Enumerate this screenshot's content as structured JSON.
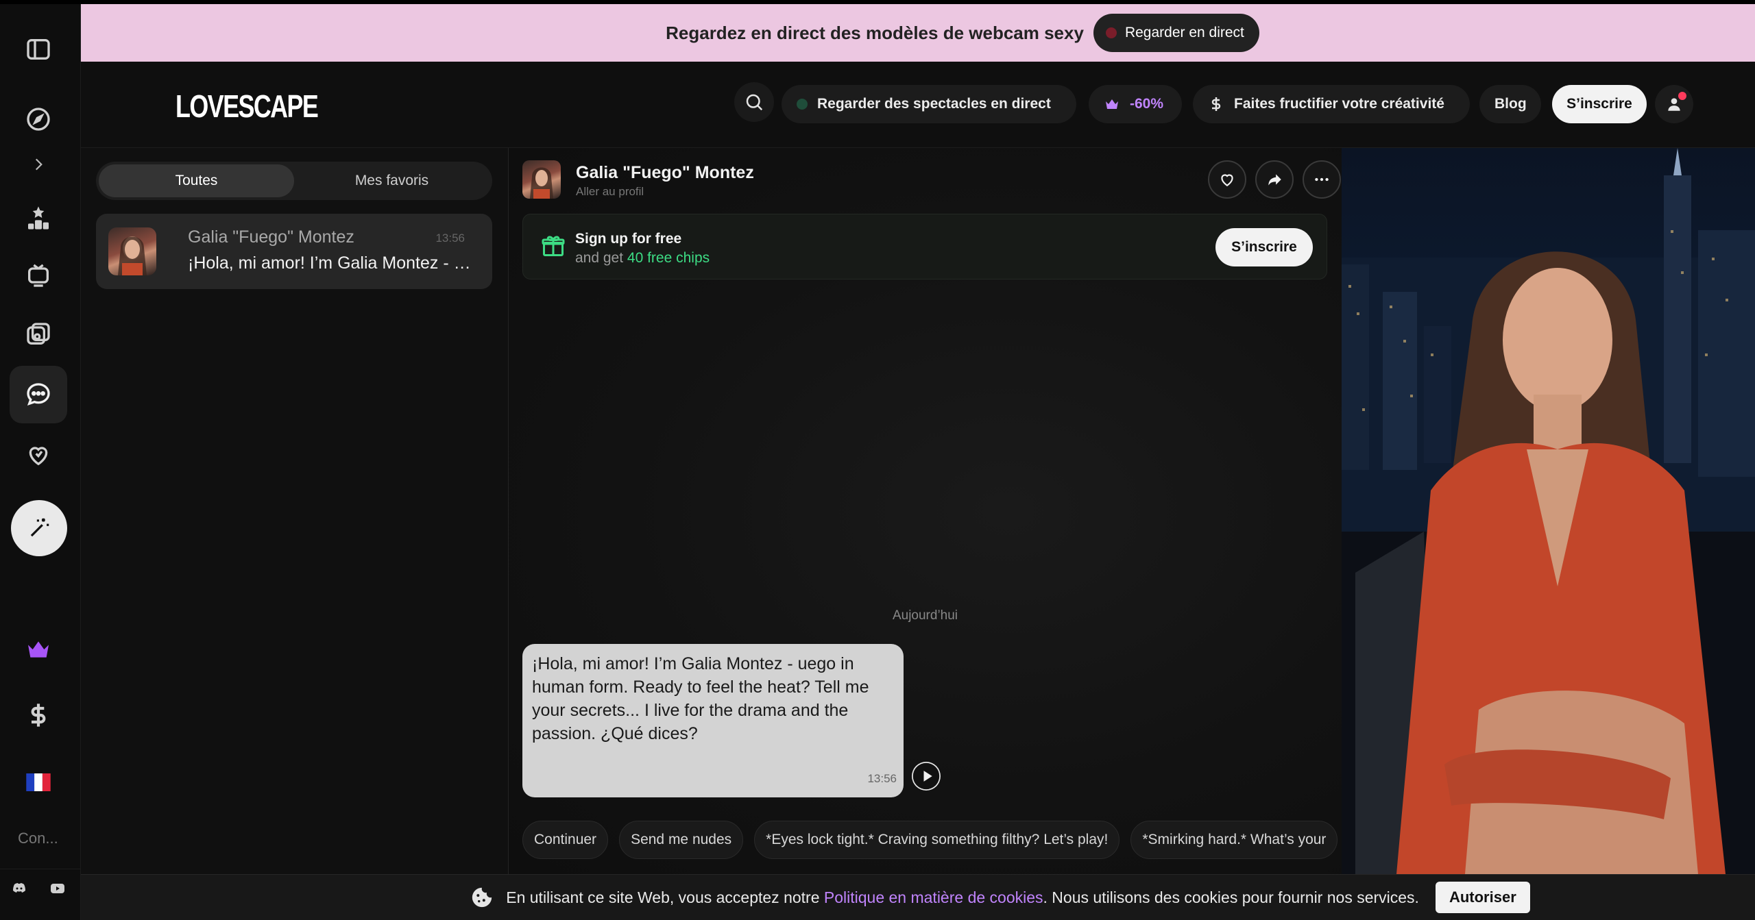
{
  "promo": {
    "text": "Regardez en direct des modèles de webcam sexy",
    "button": "Regarder en direct"
  },
  "header": {
    "logo": "LOVESCAPE",
    "live_pill": "Regarder des spectacles en direct",
    "discount_pill": "-60%",
    "earn_pill": "Faites fructifier votre créativité",
    "blog": "Blog",
    "signup": "S’inscrire"
  },
  "sidebar": {
    "footer_label": "Con..."
  },
  "conversations": {
    "tabs": [
      {
        "label": "Toutes",
        "active": true
      },
      {
        "label": "Mes favoris",
        "active": false
      }
    ],
    "items": [
      {
        "name": "Galia \"Fuego\" Montez",
        "time": "13:56",
        "preview": "¡Hola, mi amor! I’m Galia Montez - uego..."
      }
    ]
  },
  "chat": {
    "name": "Galia \"Fuego\" Montez",
    "subtitle": "Aller au profil",
    "signup_card": {
      "title": "Sign up for free",
      "subtitle_prefix": "and get ",
      "subtitle_highlight": "40 free chips",
      "button": "S’inscrire"
    },
    "date_divider": "Aujourd’hui",
    "messages": [
      {
        "text": "¡Hola, mi amor! I’m Galia Montez - uego in human form. Ready to feel the heat? Tell me your secrets... I live for the drama and the passion. ¿Qué dices?",
        "time": "13:56"
      }
    ],
    "suggestions": [
      "Continuer",
      "Send me nudes",
      "*Eyes lock tight.* Craving something filthy? Let’s play!",
      "*Smirking hard.* What’s your"
    ]
  },
  "cookie": {
    "text_before": "En utilisant ce site Web, vous acceptez notre ",
    "link": "Politique en matière de cookies",
    "text_after": ". Nous utilisons des cookies pour fournir nos services.",
    "button": "Autoriser"
  },
  "colors": {
    "promo_bg": "#ecc7e1",
    "accent_purple": "#c084fc",
    "accent_green": "#3ddc84",
    "flag_blue": "#1f3fbf",
    "flag_red": "#e2243b"
  }
}
